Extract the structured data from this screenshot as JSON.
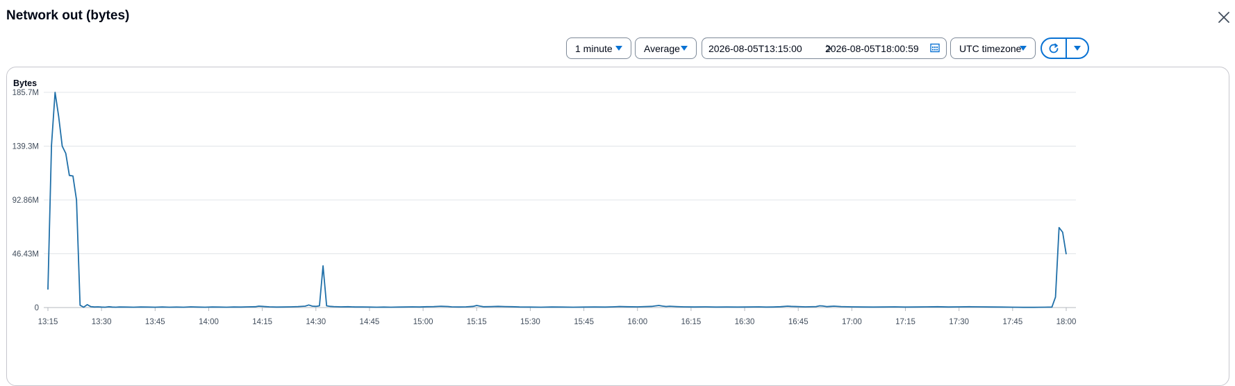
{
  "header": {
    "title": "Network out (bytes)",
    "close_icon": "close-icon"
  },
  "toolbar": {
    "period": "1 minute",
    "statistic": "Average",
    "range_start": "2026-08-05T13:15:00",
    "range_end": "2026-08-05T18:00:59",
    "timezone": "UTC timezone",
    "icons": {
      "caret": "caret-down-icon",
      "arrow": "chevron-right-icon",
      "calendar": "calendar-icon",
      "refresh": "refresh-icon"
    },
    "accent_color": "#0972d3"
  },
  "chart_data": {
    "type": "line",
    "ylabel": "Bytes",
    "ylim": [
      0,
      185.7
    ],
    "y_unit": "M",
    "yticks": [
      "0",
      "46.43M",
      "92.86M",
      "139.3M",
      "185.7M"
    ],
    "ytick_values": [
      0,
      46.43,
      92.86,
      139.3,
      185.7
    ],
    "xlim_minutes": [
      0,
      285
    ],
    "xtick_minutes": [
      0,
      15,
      30,
      45,
      60,
      75,
      90,
      105,
      120,
      135,
      150,
      165,
      180,
      195,
      210,
      225,
      240,
      255,
      270,
      285
    ],
    "xticks": [
      "13:15",
      "13:30",
      "13:45",
      "14:00",
      "14:15",
      "14:30",
      "14:45",
      "15:00",
      "15:15",
      "15:30",
      "15:45",
      "16:00",
      "16:15",
      "16:30",
      "16:45",
      "17:00",
      "17:15",
      "17:30",
      "17:45",
      "18:00"
    ],
    "grid": true,
    "line_color": "#1f6fa8",
    "series": [
      {
        "points": [
          [
            0,
            15.5
          ],
          [
            1,
            140
          ],
          [
            2,
            185.7
          ],
          [
            3,
            165
          ],
          [
            4,
            139.3
          ],
          [
            5,
            133
          ],
          [
            6,
            114
          ],
          [
            7,
            113.5
          ],
          [
            8,
            92.86
          ],
          [
            9,
            2
          ],
          [
            10,
            0.3
          ],
          [
            11,
            2.5
          ],
          [
            12,
            0.8
          ],
          [
            13,
            0.5
          ],
          [
            14,
            0.6
          ],
          [
            15,
            0.4
          ],
          [
            16,
            0.3
          ],
          [
            17,
            0.7
          ],
          [
            18,
            0.4
          ],
          [
            19,
            0.3
          ],
          [
            20,
            0.5
          ],
          [
            22,
            0.4
          ],
          [
            24,
            0.3
          ],
          [
            26,
            0.5
          ],
          [
            28,
            0.4
          ],
          [
            30,
            0.3
          ],
          [
            32,
            0.5
          ],
          [
            34,
            0.3
          ],
          [
            36,
            0.4
          ],
          [
            38,
            0.3
          ],
          [
            40,
            0.6
          ],
          [
            42,
            0.4
          ],
          [
            44,
            0.3
          ],
          [
            46,
            0.5
          ],
          [
            48,
            0.4
          ],
          [
            50,
            0.3
          ],
          [
            52,
            0.5
          ],
          [
            54,
            0.4
          ],
          [
            56,
            0.6
          ],
          [
            58,
            0.7
          ],
          [
            59,
            1.2
          ],
          [
            60,
            1
          ],
          [
            62,
            0.6
          ],
          [
            64,
            0.4
          ],
          [
            66,
            0.5
          ],
          [
            68,
            0.6
          ],
          [
            70,
            0.8
          ],
          [
            72,
            1.2
          ],
          [
            73,
            2.2
          ],
          [
            74,
            1.2
          ],
          [
            75,
            1
          ],
          [
            76,
            1.5
          ],
          [
            77,
            36
          ],
          [
            78,
            1.5
          ],
          [
            79,
            1
          ],
          [
            80,
            0.8
          ],
          [
            82,
            0.6
          ],
          [
            84,
            0.7
          ],
          [
            86,
            0.5
          ],
          [
            88,
            0.5
          ],
          [
            90,
            0.4
          ],
          [
            92,
            0.3
          ],
          [
            94,
            0.4
          ],
          [
            96,
            0.3
          ],
          [
            98,
            0.4
          ],
          [
            100,
            0.5
          ],
          [
            102,
            0.6
          ],
          [
            104,
            0.5
          ],
          [
            106,
            0.7
          ],
          [
            108,
            0.8
          ],
          [
            110,
            1.1
          ],
          [
            112,
            0.9
          ],
          [
            113,
            0.6
          ],
          [
            115,
            0.5
          ],
          [
            117,
            0.6
          ],
          [
            119,
            1
          ],
          [
            120,
            1.8
          ],
          [
            121,
            1.2
          ],
          [
            122,
            0.7
          ],
          [
            124,
            0.8
          ],
          [
            126,
            1
          ],
          [
            128,
            0.8
          ],
          [
            130,
            0.7
          ],
          [
            132,
            0.5
          ],
          [
            135,
            0.4
          ],
          [
            138,
            0.3
          ],
          [
            141,
            0.5
          ],
          [
            144,
            0.4
          ],
          [
            147,
            0.3
          ],
          [
            150,
            0.4
          ],
          [
            153,
            0.5
          ],
          [
            156,
            0.4
          ],
          [
            158,
            0.6
          ],
          [
            160,
            0.9
          ],
          [
            162,
            0.7
          ],
          [
            165,
            0.6
          ],
          [
            167,
            0.8
          ],
          [
            169,
            1
          ],
          [
            170,
            1.4
          ],
          [
            171,
            1.8
          ],
          [
            172,
            1.3
          ],
          [
            173,
            0.9
          ],
          [
            174,
            1.1
          ],
          [
            176,
            0.8
          ],
          [
            178,
            0.6
          ],
          [
            181,
            0.5
          ],
          [
            184,
            0.6
          ],
          [
            187,
            0.4
          ],
          [
            190,
            0.5
          ],
          [
            193,
            0.4
          ],
          [
            196,
            0.5
          ],
          [
            199,
            0.6
          ],
          [
            201,
            0.4
          ],
          [
            203,
            0.5
          ],
          [
            205,
            0.7
          ],
          [
            207,
            1.2
          ],
          [
            208,
            1
          ],
          [
            210,
            0.8
          ],
          [
            212,
            0.6
          ],
          [
            215,
            0.8
          ],
          [
            216,
            1.5
          ],
          [
            217,
            1.3
          ],
          [
            218,
            0.8
          ],
          [
            219,
            1
          ],
          [
            220,
            1.2
          ],
          [
            222,
            0.8
          ],
          [
            225,
            0.6
          ],
          [
            228,
            0.5
          ],
          [
            231,
            0.4
          ],
          [
            234,
            0.5
          ],
          [
            237,
            0.6
          ],
          [
            240,
            0.4
          ],
          [
            243,
            0.5
          ],
          [
            246,
            0.6
          ],
          [
            249,
            0.7
          ],
          [
            252,
            0.5
          ],
          [
            255,
            0.6
          ],
          [
            258,
            0.7
          ],
          [
            261,
            0.6
          ],
          [
            264,
            0.5
          ],
          [
            267,
            0.4
          ],
          [
            270,
            0.3
          ],
          [
            273,
            0.2
          ],
          [
            276,
            0.2
          ],
          [
            279,
            0.3
          ],
          [
            281,
            0.4
          ],
          [
            282,
            9
          ],
          [
            283,
            69
          ],
          [
            284,
            65
          ],
          [
            285,
            46
          ]
        ]
      }
    ]
  }
}
